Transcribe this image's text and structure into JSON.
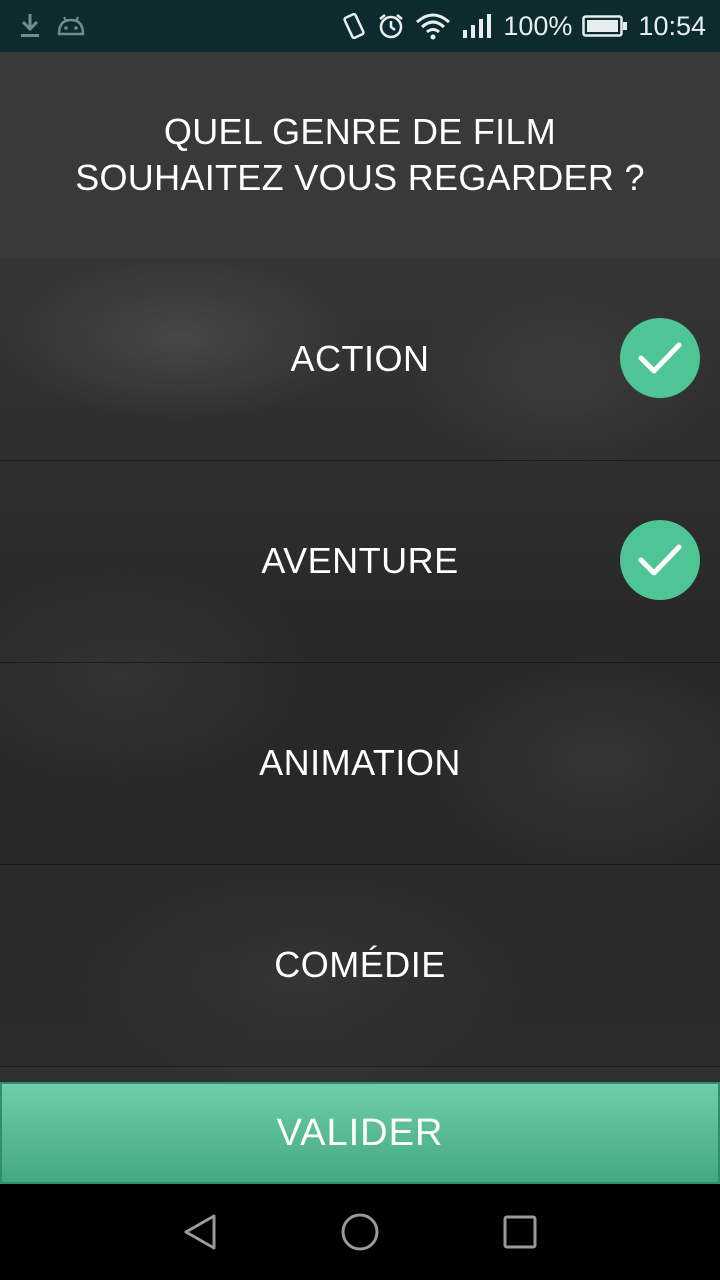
{
  "status_bar": {
    "left_icons": [
      "download-icon",
      "android-debug-icon"
    ],
    "right_icons": [
      "vibrate-icon",
      "alarm-icon",
      "wifi-icon",
      "signal-icon"
    ],
    "battery": "100%",
    "time": "10:54"
  },
  "header": {
    "title_line1": "QUEL GENRE DE FILM",
    "title_line2": "SOUHAITEZ VOUS REGARDER ?"
  },
  "genres": [
    {
      "label": "ACTION",
      "selected": true
    },
    {
      "label": "AVENTURE",
      "selected": true
    },
    {
      "label": "ANIMATION",
      "selected": false
    },
    {
      "label": "COMÉDIE",
      "selected": false
    }
  ],
  "validate_button": {
    "label": "VALIDER"
  },
  "nav_bar": {
    "buttons": [
      "back-icon",
      "home-icon",
      "recents-icon"
    ]
  },
  "colors": {
    "accent": "#4fc595",
    "header_bg": "#393939",
    "status_bar_bg": "#0d2a2f"
  }
}
